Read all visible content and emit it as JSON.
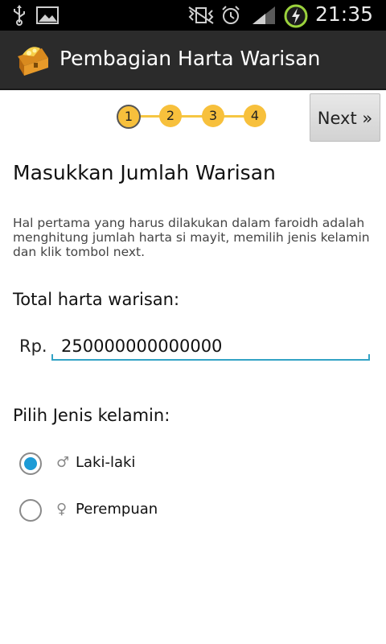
{
  "status_bar": {
    "time": "21:35",
    "icons": [
      "usb-icon",
      "gallery-icon",
      "vibrate-icon",
      "alarm-icon",
      "signal-icon",
      "battery-charging-icon"
    ]
  },
  "action_bar": {
    "app_icon": "treasure-chest-icon",
    "title": "Pembagian Harta Warisan"
  },
  "steps": {
    "items": [
      "1",
      "2",
      "3",
      "4"
    ],
    "active": "1",
    "color": "#f7c03c"
  },
  "next_button": {
    "label": "Next »"
  },
  "page": {
    "heading": "Masukkan Jumlah Warisan",
    "description": "Hal pertama yang harus dilakukan dalam faroidh adalah menghitung jumlah harta si mayit, memilih jenis kelamin dan klik tombol next."
  },
  "amount": {
    "label": "Total harta warisan:",
    "prefix": "Rp.",
    "value": "250000000000000",
    "accent": "#33a3c5"
  },
  "gender": {
    "label": "Pilih Jenis kelamin:",
    "options": [
      {
        "symbol": "♂",
        "label": "Laki-laki",
        "checked": true
      },
      {
        "symbol": "♀",
        "label": "Perempuan",
        "checked": false
      }
    ],
    "accent": "#1d9bd6"
  }
}
